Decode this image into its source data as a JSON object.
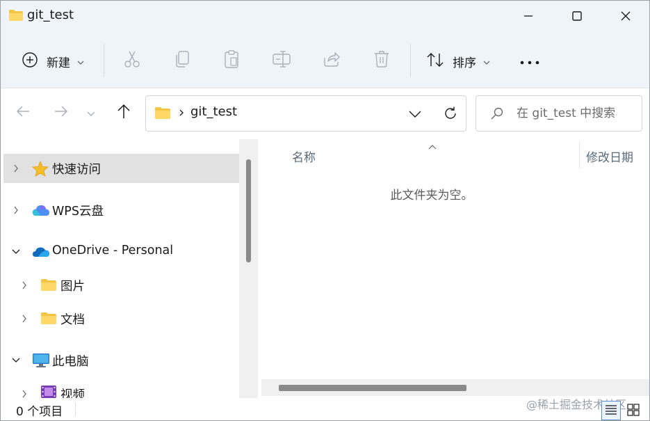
{
  "window": {
    "title": "git_test"
  },
  "toolbar": {
    "new_label": "新建",
    "sort_label": "排序",
    "tools": [
      "cut-icon",
      "copy-icon",
      "paste-icon",
      "rename-icon",
      "share-icon",
      "delete-icon"
    ]
  },
  "nav": {
    "breadcrumb": [
      "git_test"
    ],
    "search_placeholder": "在 git_test 中搜索"
  },
  "sidebar": {
    "items": [
      {
        "label": "快速访问",
        "icon": "star-icon",
        "expanded": false,
        "selected": true,
        "level": 0
      },
      {
        "label": "WPS云盘",
        "icon": "wps-cloud-icon",
        "expanded": false,
        "selected": false,
        "level": 0
      },
      {
        "label": "OneDrive - Personal",
        "icon": "onedrive-icon",
        "expanded": true,
        "selected": false,
        "level": 0
      },
      {
        "label": "图片",
        "icon": "folder-icon",
        "expanded": false,
        "selected": false,
        "level": 1
      },
      {
        "label": "文档",
        "icon": "folder-icon",
        "expanded": false,
        "selected": false,
        "level": 1
      },
      {
        "label": "此电脑",
        "icon": "monitor-icon",
        "expanded": true,
        "selected": false,
        "level": 0
      },
      {
        "label": "视频",
        "icon": "video-folder-icon",
        "expanded": false,
        "selected": false,
        "level": 1
      }
    ]
  },
  "content": {
    "columns": [
      "名称",
      "修改日期"
    ],
    "empty_message": "此文件夹为空。"
  },
  "status": {
    "item_count": "0 个项目",
    "watermark": "@稀土掘金技术社区"
  },
  "colors": {
    "chrome_bg": "#eff4f9",
    "selection": "#e1e1e1",
    "folder": "#f4c542",
    "accent": "#1a73c8"
  }
}
